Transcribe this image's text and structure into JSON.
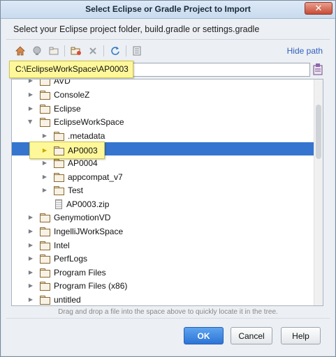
{
  "window": {
    "title": "Select Eclipse or Gradle Project to Import",
    "close_symbol": "✕"
  },
  "description": "Select your Eclipse project folder, build.gradle or settings.gradle",
  "toolbar": {
    "hide_path_label": "Hide path"
  },
  "path": {
    "value": "C:\\EclipseWorkSpace\\AP0003"
  },
  "tree": {
    "rows": [
      {
        "label": "AVD",
        "expanded": false
      },
      {
        "label": "ConsoleZ",
        "expanded": false
      },
      {
        "label": "Eclipse",
        "expanded": false
      },
      {
        "label": "EclipseWorkSpace",
        "expanded": true
      },
      {
        "label": ".metadata",
        "expanded": false
      },
      {
        "label": "AP0003",
        "expanded": false,
        "selected": true
      },
      {
        "label": "AP0004",
        "expanded": false
      },
      {
        "label": "appcompat_v7",
        "expanded": false
      },
      {
        "label": "Test",
        "expanded": false
      },
      {
        "label": "AP0003.zip",
        "type": "file"
      },
      {
        "label": "GenymotionVD",
        "expanded": false
      },
      {
        "label": "IngelliJWorkSpace",
        "expanded": false
      },
      {
        "label": "Intel",
        "expanded": false
      },
      {
        "label": "PerfLogs",
        "expanded": false
      },
      {
        "label": "Program Files",
        "expanded": false
      },
      {
        "label": "Program Files (x86)",
        "expanded": false
      },
      {
        "label": "untitled",
        "expanded": false
      }
    ]
  },
  "hint": "Drag and drop a file into the space above to quickly locate it in the tree.",
  "buttons": {
    "ok": "OK",
    "cancel": "Cancel",
    "help": "Help"
  },
  "colors": {
    "selection": "#3575cf",
    "highlight": "#fff89a",
    "link": "#2f5fbf",
    "ok_button": "#2d74d6"
  }
}
